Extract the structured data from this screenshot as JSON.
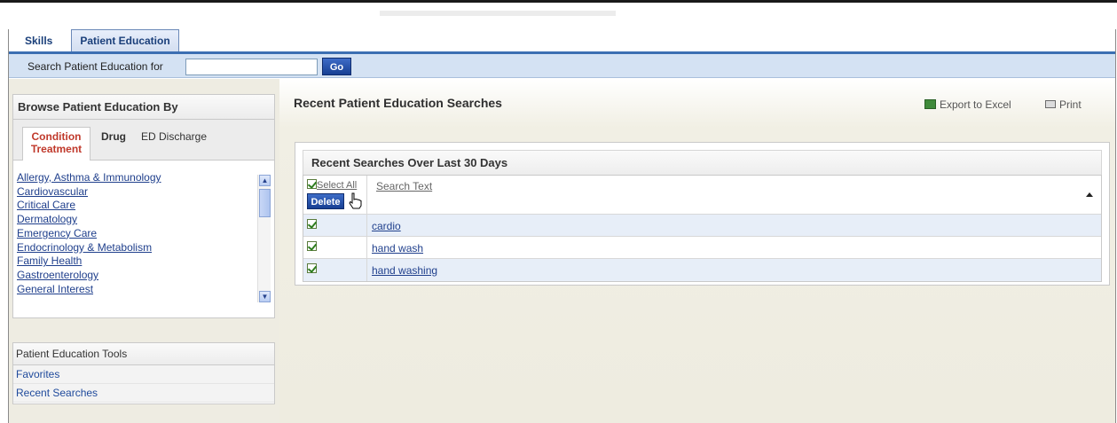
{
  "tabs": [
    {
      "label": "Skills"
    },
    {
      "label": "Patient Education"
    }
  ],
  "search": {
    "label": "Search Patient Education for",
    "value": "",
    "go_label": "Go"
  },
  "browse": {
    "title": "Browse Patient Education By",
    "subtabs": [
      {
        "label": "Condition Treatment",
        "active": true
      },
      {
        "label": "Drug"
      },
      {
        "label": "ED Discharge"
      }
    ],
    "conditions": [
      "Allergy, Asthma & Immunology",
      "Cardiovascular",
      "Critical Care",
      "Dermatology",
      "Emergency Care",
      "Endocrinology & Metabolism",
      "Family Health",
      "Gastroenterology",
      "General Interest"
    ]
  },
  "tools": {
    "title": "Patient Education Tools",
    "items": [
      "Favorites",
      "Recent Searches"
    ]
  },
  "main": {
    "title": "Recent Patient Education Searches",
    "export_label": "Export to Excel",
    "export_icon": "excel-icon",
    "print_label": "Print",
    "print_icon": "printer-icon"
  },
  "recent": {
    "title": "Recent Searches Over Last 30 Days",
    "select_all_label": "Select All",
    "delete_label": "Delete",
    "column_header": "Search Text",
    "rows": [
      {
        "text": "cardio",
        "checked": true
      },
      {
        "text": "hand wash",
        "checked": true
      },
      {
        "text": "hand washing",
        "checked": true
      }
    ]
  },
  "colors": {
    "accent_blue": "#3c6fb2",
    "button_blue": "#173f93",
    "active_subtab": "#c0392b"
  }
}
